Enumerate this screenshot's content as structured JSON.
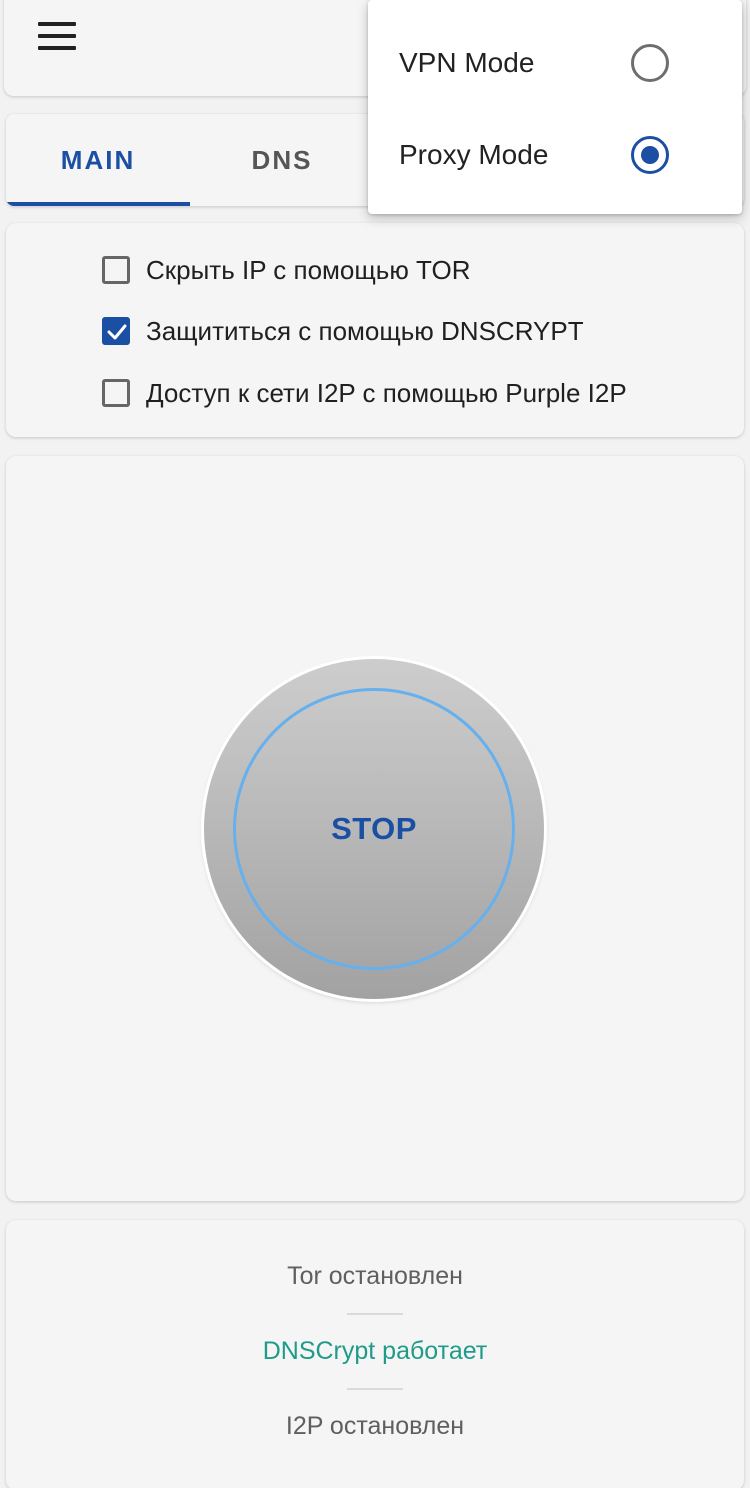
{
  "tabs": [
    {
      "label": "MAIN",
      "active": true
    },
    {
      "label": "DNS",
      "active": false
    }
  ],
  "options": [
    {
      "label": "Скрыть IP с помощью TOR",
      "checked": false
    },
    {
      "label": "Защититься с помощью DNSCRYPT",
      "checked": true
    },
    {
      "label": "Доступ к сети I2P с помощью Purple I2P",
      "checked": false
    }
  ],
  "main_button": {
    "label": "STOP"
  },
  "status": [
    {
      "text": "Tor остановлен",
      "state": "stopped"
    },
    {
      "text": "DNSCrypt работает",
      "state": "running"
    },
    {
      "text": "I2P остановлен",
      "state": "stopped"
    }
  ],
  "mode_menu": [
    {
      "label": "VPN Mode",
      "selected": false
    },
    {
      "label": "Proxy Mode",
      "selected": true
    }
  ],
  "colors": {
    "accent": "#1a4fa3",
    "running": "#1f9b8a",
    "ring": "#66b0ee"
  },
  "icons": {
    "menu": "hamburger-menu-icon",
    "check": "checkmark-icon"
  }
}
